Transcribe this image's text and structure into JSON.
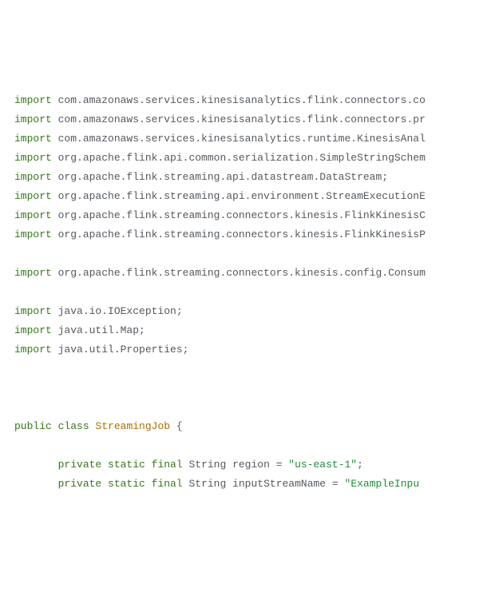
{
  "code": {
    "lines": [
      {
        "kw1": "import",
        "rest": " com.amazonaws.services.kinesisanalytics.flink.connectors.co"
      },
      {
        "kw1": "import",
        "rest": " com.amazonaws.services.kinesisanalytics.flink.connectors.pr"
      },
      {
        "kw1": "import",
        "rest": " com.amazonaws.services.kinesisanalytics.runtime.KinesisAnal"
      },
      {
        "kw1": "import",
        "rest": " org.apache.flink.api.common.serialization.SimpleStringSchem"
      },
      {
        "kw1": "import",
        "rest": " org.apache.flink.streaming.api.datastream.DataStream;"
      },
      {
        "kw1": "import",
        "rest": " org.apache.flink.streaming.api.environment.StreamExecutionE"
      },
      {
        "kw1": "import",
        "rest": " org.apache.flink.streaming.connectors.kinesis.FlinkKinesisC"
      },
      {
        "kw1": "import",
        "rest": " org.apache.flink.streaming.connectors.kinesis.FlinkKinesisP"
      }
    ],
    "line9": {
      "kw1": "import",
      "rest": " org.apache.flink.streaming.connectors.kinesis.config.Consum"
    },
    "ioImports": [
      {
        "kw1": "import",
        "rest": " java.io.IOException;"
      },
      {
        "kw1": "import",
        "rest": " java.util.Map;"
      },
      {
        "kw1": "import",
        "rest": " java.util.Properties;"
      }
    ],
    "classLine": {
      "kw1": "public",
      "kw2": "class",
      "name": "StreamingJob",
      "tail": " {"
    },
    "f1": {
      "indent": "       ",
      "kw1": "private",
      "kw2": "static",
      "kw3": "final",
      "type": " String region = ",
      "str": "\"us-east-1\"",
      "tail": ";"
    },
    "f2": {
      "indent": "       ",
      "kw1": "private",
      "kw2": "static",
      "kw3": "final",
      "type": " String inputStreamName = ",
      "str": "\"ExampleInpu"
    }
  }
}
